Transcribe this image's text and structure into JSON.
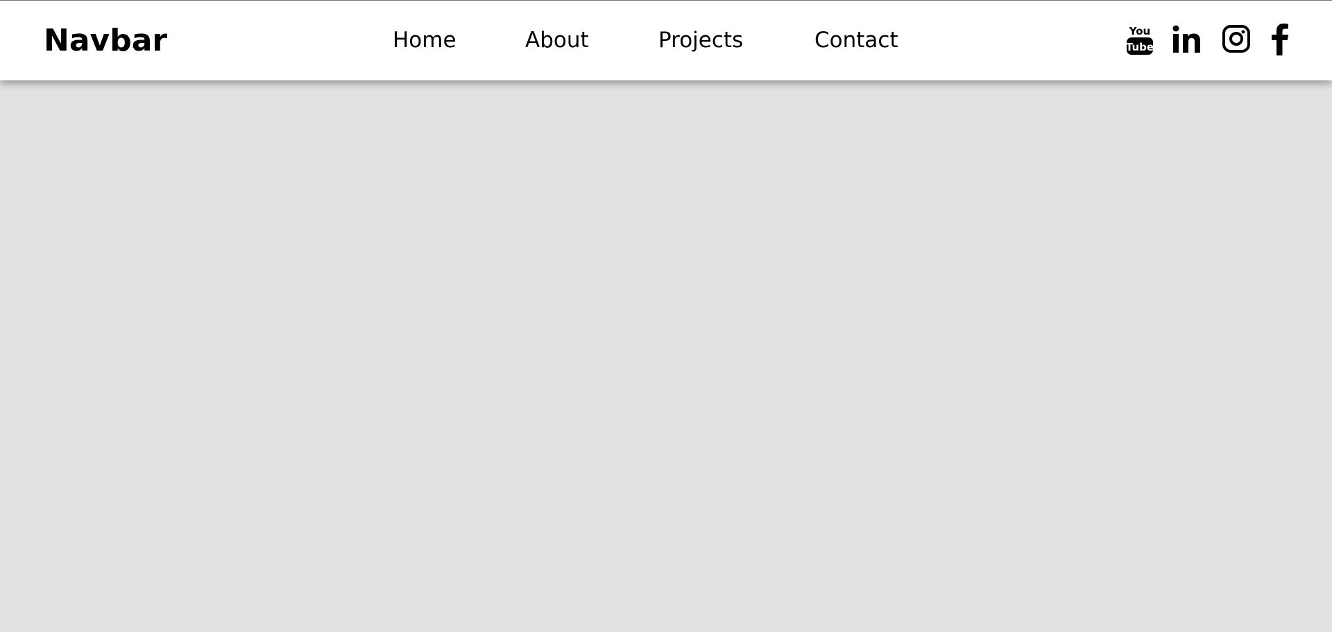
{
  "navbar": {
    "brand": "Navbar",
    "links": [
      "Home",
      "About",
      "Projects",
      "Contact"
    ],
    "social_icons": [
      "youtube-icon",
      "linkedin-icon",
      "instagram-icon",
      "facebook-icon"
    ],
    "youtube_text_top": "You",
    "youtube_text_bottom": "Tube"
  },
  "colors": {
    "navbar_background": "#ffffff",
    "page_background": "#e1e1e1",
    "text": "#000000"
  }
}
